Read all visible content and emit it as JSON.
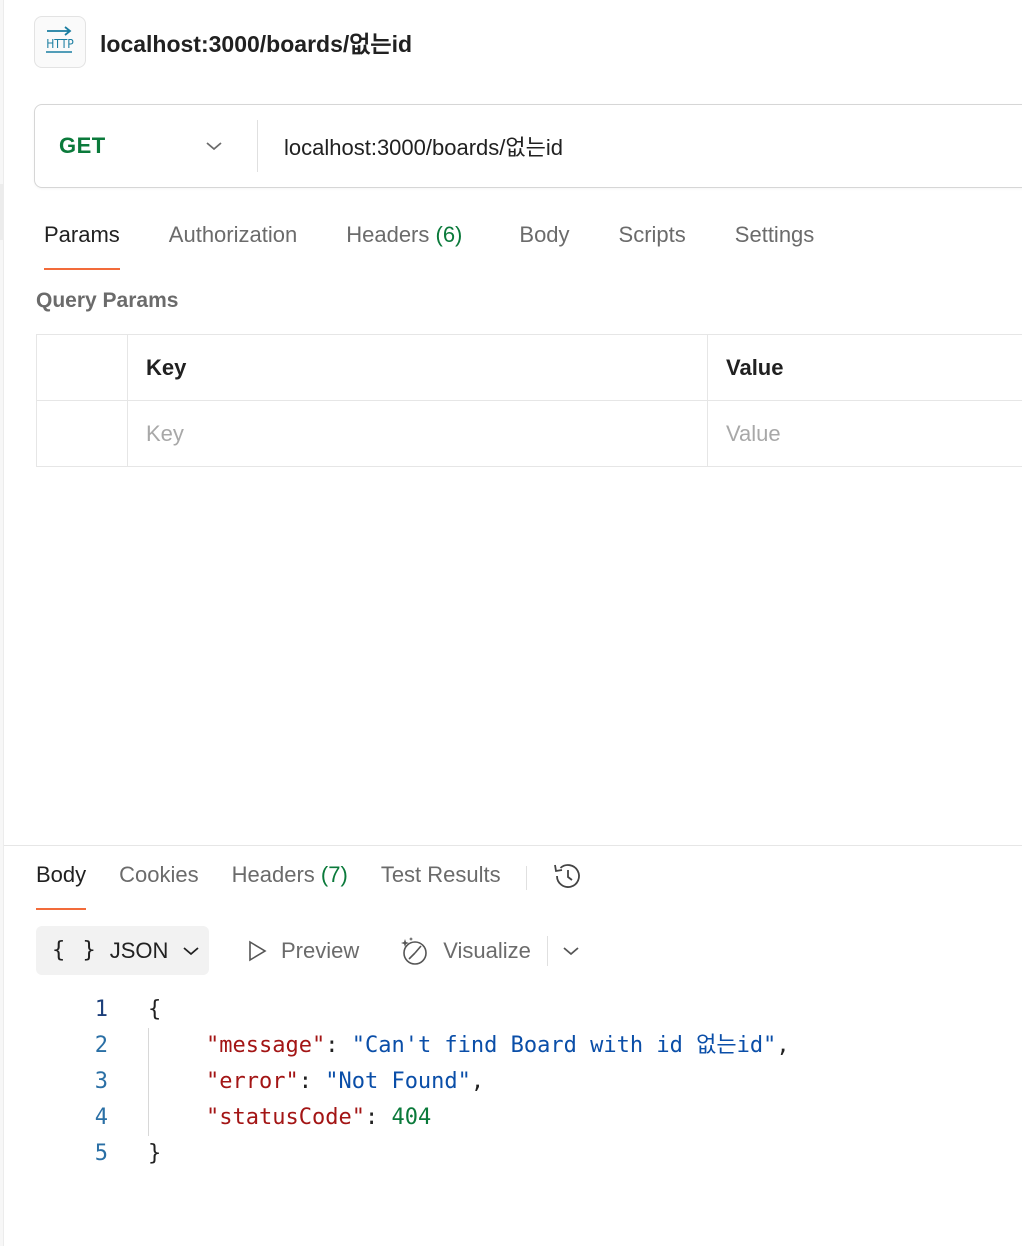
{
  "header": {
    "badge_text": "HTTP",
    "title": "localhost:3000/boards/없는id"
  },
  "request": {
    "method": "GET",
    "url": "localhost:3000/boards/없는id"
  },
  "request_tabs": [
    {
      "label": "Params",
      "count": ""
    },
    {
      "label": "Authorization",
      "count": ""
    },
    {
      "label": "Headers",
      "count": "(6)"
    },
    {
      "label": "Body",
      "count": ""
    },
    {
      "label": "Scripts",
      "count": ""
    },
    {
      "label": "Settings",
      "count": ""
    }
  ],
  "query_params": {
    "title": "Query Params",
    "headers": {
      "key": "Key",
      "value": "Value"
    },
    "placeholders": {
      "key": "Key",
      "value": "Value"
    }
  },
  "response_tabs": [
    {
      "label": "Body",
      "count": ""
    },
    {
      "label": "Cookies",
      "count": ""
    },
    {
      "label": "Headers",
      "count": "(7)"
    },
    {
      "label": "Test Results",
      "count": ""
    }
  ],
  "format_bar": {
    "braces": "{ }",
    "format": "JSON",
    "preview": "Preview",
    "visualize": "Visualize"
  },
  "response_body": {
    "line_numbers": [
      "1",
      "2",
      "3",
      "4",
      "5"
    ],
    "open_brace": "{",
    "close_brace": "}",
    "fields": [
      {
        "key": "\"message\"",
        "colon": ": ",
        "value": "\"Can't find Board with id 없는id\"",
        "suffix": ","
      },
      {
        "key": "\"error\"",
        "colon": ": ",
        "value": "\"Not Found\"",
        "suffix": ","
      },
      {
        "key": "\"statusCode\"",
        "colon": ": ",
        "value": "404",
        "suffix": ""
      }
    ]
  },
  "icons": [
    "http-icon",
    "chevron-down-icon",
    "history-icon",
    "play-icon",
    "visualize-icon"
  ],
  "colors": {
    "method_green": "#0b7a3b",
    "active_tab_underline": "#f26b3a",
    "json_key": "#a31515",
    "json_string": "#0a4ea8",
    "json_number": "#0b7a3b"
  }
}
